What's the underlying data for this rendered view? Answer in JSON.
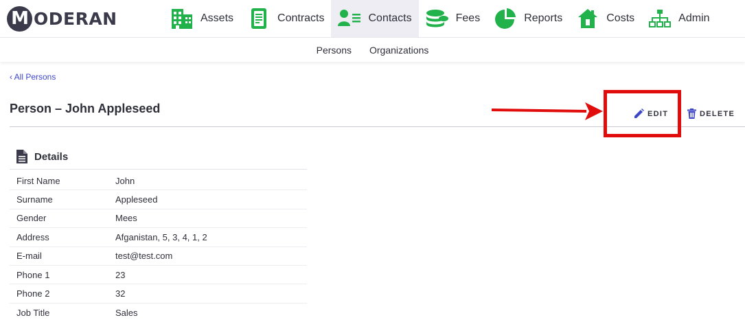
{
  "brand": {
    "logo_mark": "M",
    "logo_text": "ODERAN"
  },
  "nav": [
    {
      "label": "Assets",
      "icon": "building-icon"
    },
    {
      "label": "Contracts",
      "icon": "document-icon"
    },
    {
      "label": "Contacts",
      "icon": "contacts-icon",
      "active": true
    },
    {
      "label": "Fees",
      "icon": "coins-icon"
    },
    {
      "label": "Reports",
      "icon": "pie-chart-icon"
    },
    {
      "label": "Costs",
      "icon": "house-cost-icon"
    },
    {
      "label": "Admin",
      "icon": "sitemap-icon"
    }
  ],
  "subnav": {
    "persons": "Persons",
    "organizations": "Organizations"
  },
  "breadcrumb": "‹ All Persons",
  "page": {
    "title": "Person – John Appleseed"
  },
  "actions": {
    "edit": "EDIT",
    "delete": "DELETE"
  },
  "details": {
    "title": "Details",
    "rows": [
      {
        "label": "First Name",
        "value": "John"
      },
      {
        "label": "Surname",
        "value": "Appleseed"
      },
      {
        "label": "Gender",
        "value": "Mees"
      },
      {
        "label": "Address",
        "value": "Afganistan, 5, 3, 4, 1, 2"
      },
      {
        "label": "E-mail",
        "value": "test@test.com"
      },
      {
        "label": "Phone 1",
        "value": "23"
      },
      {
        "label": "Phone 2",
        "value": "32"
      },
      {
        "label": "Job Title",
        "value": "Sales"
      }
    ]
  },
  "colors": {
    "brand_green": "#21b24b",
    "accent_blue": "#3d46c7",
    "annotation_red": "#e10c0c",
    "dark": "#3a3a4a"
  }
}
